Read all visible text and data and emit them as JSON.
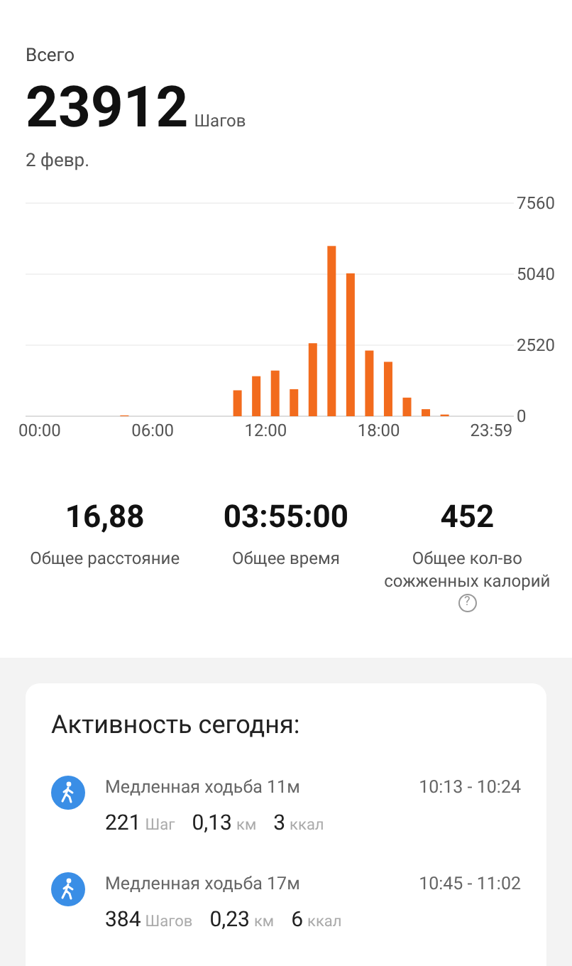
{
  "header": {
    "label": "Всего",
    "steps": "23912",
    "unit": "Шагов",
    "date": "2 февр."
  },
  "chart": {
    "chart_data": {
      "type": "bar",
      "x": [
        4.5,
        10.5,
        11.5,
        12.5,
        13.5,
        14.5,
        15.5,
        16.5,
        17.5,
        18.5,
        19.5,
        20.5,
        21.5
      ],
      "series": [
        {
          "color": "#f26b1d",
          "values": [
            30,
            920,
            1420,
            1620,
            960,
            2590,
            6040,
            5070,
            2330,
            1930,
            660,
            250,
            60
          ]
        }
      ],
      "xlim": [
        -0.75,
        25.17
      ],
      "ylim": [
        0,
        7560
      ],
      "yticks": [
        0,
        2520,
        5040,
        7560
      ],
      "xticks": [
        {
          "value": 0,
          "label": "00:00"
        },
        {
          "value": 6,
          "label": "06:00"
        },
        {
          "value": 12,
          "label": "12:00"
        },
        {
          "value": 18,
          "label": "18:00"
        },
        {
          "value": 23.983,
          "label": "23:59"
        }
      ]
    }
  },
  "stats": [
    {
      "value": "16,88",
      "label": "Общее расстояние"
    },
    {
      "value": "03:55:00",
      "label": "Общее время"
    },
    {
      "value": "452",
      "label": "Общее кол-во сожженных калорий",
      "help": "?"
    }
  ],
  "activity": {
    "title": "Активность сегодня:",
    "items": [
      {
        "name": "Медленная ходьба 11м",
        "time": "10:13 - 10:24",
        "steps": "221",
        "steps_unit": "Шаг",
        "distance": "0,13",
        "distance_unit": "км",
        "calories": "3",
        "calories_unit": "ккал"
      },
      {
        "name": "Медленная ходьба 17м",
        "time": "10:45 - 11:02",
        "steps": "384",
        "steps_unit": "Шагов",
        "distance": "0,23",
        "distance_unit": "км",
        "calories": "6",
        "calories_unit": "ккал"
      }
    ]
  }
}
